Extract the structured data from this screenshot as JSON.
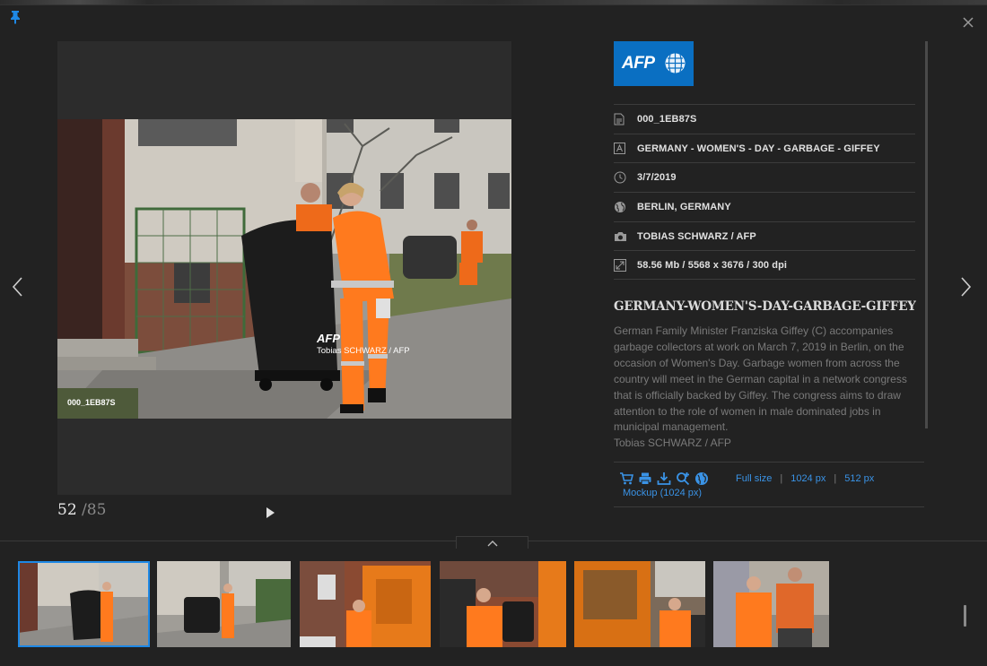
{
  "viewer": {
    "watermark_logo": "AFP",
    "watermark_credit": "Tobias SCHWARZ / AFP",
    "photo_id_label": "000_1EB87S",
    "counter_current": "52",
    "counter_total": "/85"
  },
  "panel": {
    "logo_text": "AFP",
    "metadata": [
      {
        "icon": "document-icon",
        "text": "000_1EB87S"
      },
      {
        "icon": "title-icon",
        "text": "GERMANY - WOMEN'S - DAY - GARBAGE - GIFFEY"
      },
      {
        "icon": "clock-icon",
        "text": "3/7/2019"
      },
      {
        "icon": "globe-icon",
        "text": "BERLIN, GERMANY"
      },
      {
        "icon": "camera-icon",
        "text": "TOBIAS SCHWARZ / AFP"
      },
      {
        "icon": "resize-icon",
        "text": "58.56 Mb / 5568 x 3676 / 300 dpi"
      }
    ],
    "headline": "GERMANY-WOMEN'S-DAY-GARBAGE-GIFFEY",
    "caption": "German Family Minister Franziska Giffey (C) accompanies garbage collectors at work on March 7, 2019 in Berlin, on the occasion of Women's Day. Garbage women from across the country will meet in the German capital in a network congress that is officially backed by Giffey. The congress aims to draw attention to the role of women in male dominated jobs in municipal management.",
    "credit": "Tobias SCHWARZ / AFP",
    "actions": {
      "icons": [
        "cart-icon",
        "print-icon",
        "download-icon",
        "zoom-in-icon",
        "globe-icon"
      ],
      "full_size": "Full size",
      "size_1024": "1024 px",
      "size_512": "512 px",
      "separator": "|",
      "mockup": "Mockup (1024 px)"
    }
  },
  "colors": {
    "background": "#222222",
    "accent": "#1e88e5",
    "link": "#3a93e6",
    "afp_blue": "#0a6fc2"
  }
}
